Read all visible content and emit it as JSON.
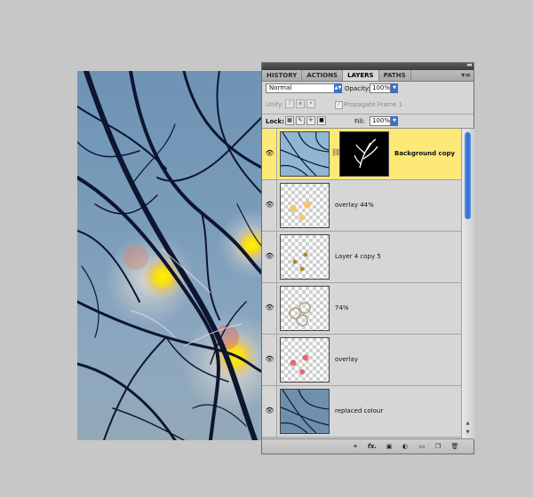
{
  "panel": {
    "tabs": [
      {
        "label": "HISTORY",
        "active": false
      },
      {
        "label": "ACTIONS",
        "active": false
      },
      {
        "label": "LAYERS",
        "active": true
      },
      {
        "label": "PATHS",
        "active": false
      }
    ],
    "collapse_glyph": "◂◂",
    "menu_glyph": "▾≡"
  },
  "blend": {
    "mode": "Normal",
    "opacity_label": "Opacity:",
    "opacity": "100%"
  },
  "unify": {
    "label": "Unify:",
    "propagate_label": "Propagate Frame 1",
    "propagate_checked": true
  },
  "lock": {
    "label": "Lock:",
    "fill_label": "Fill:",
    "fill": "100%"
  },
  "layers": [
    {
      "name": "Background copy",
      "selected": true,
      "thumb": "photo",
      "mask": true
    },
    {
      "name": "overlay  44%",
      "selected": false,
      "thumb": "orange-dots"
    },
    {
      "name": "Layer 4 copy 5",
      "selected": false,
      "thumb": "olive-dots"
    },
    {
      "name": "74%",
      "selected": false,
      "thumb": "bubbles"
    },
    {
      "name": "overlay",
      "selected": false,
      "thumb": "red-dots"
    },
    {
      "name": "replaced colour",
      "selected": false,
      "thumb": "photo"
    }
  ],
  "footer_icons": [
    "link-icon",
    "fx-icon",
    "mask-icon",
    "adjustment-icon",
    "group-folder-icon",
    "new-layer-icon",
    "trash-icon"
  ],
  "colors": {
    "selected_layer": "#fde978",
    "accent_blue": "#3b6fd1"
  }
}
